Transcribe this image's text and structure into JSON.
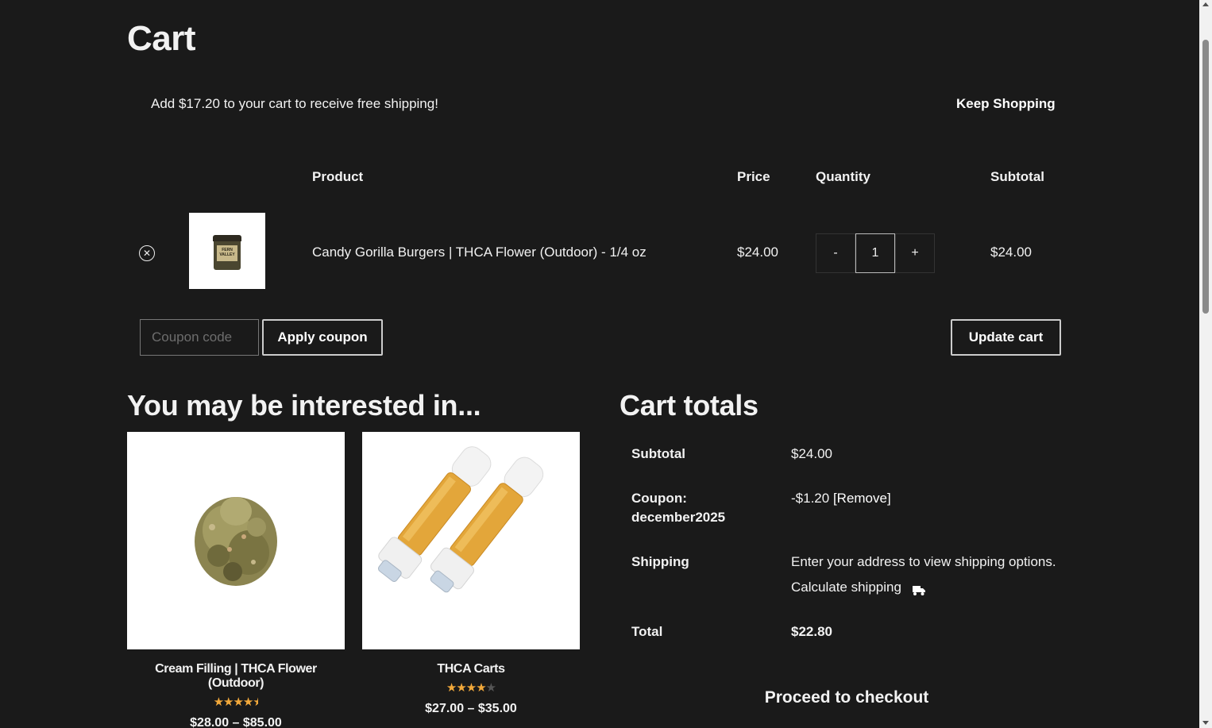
{
  "page": {
    "title": "Cart"
  },
  "notice": {
    "text": "Add $17.20 to your cart to receive free shipping!",
    "link_label": "Keep Shopping"
  },
  "cart_table": {
    "headers": {
      "product": "Product",
      "price": "Price",
      "quantity": "Quantity",
      "subtotal": "Subtotal"
    },
    "items": [
      {
        "remove_icon": "close-circle-icon",
        "thumbnail_label": "FERN VALLEY",
        "name": "Candy Gorilla Burgers | THCA Flower (Outdoor) - 1/4 oz",
        "price": "$24.00",
        "quantity": "1",
        "decrement_label": "-",
        "increment_label": "+",
        "subtotal": "$24.00"
      }
    ]
  },
  "coupon": {
    "placeholder": "Coupon code",
    "apply_label": "Apply coupon",
    "update_label": "Update cart"
  },
  "cross_sells": {
    "title": "You may be interested in...",
    "products": [
      {
        "name": "Cream Filling | THCA Flower (Outdoor)",
        "rating": 4.5,
        "price": "$28.00 – $85.00"
      },
      {
        "name": "THCA Carts",
        "rating": 4.0,
        "price": "$27.00 – $35.00"
      }
    ]
  },
  "cart_totals": {
    "title": "Cart totals",
    "subtotal_label": "Subtotal",
    "subtotal_value": "$24.00",
    "coupon_label_line1": "Coupon:",
    "coupon_label_line2": "december2025",
    "coupon_value": "-$1.20",
    "coupon_remove": "[Remove]",
    "shipping_label": "Shipping",
    "shipping_text": "Enter your address to view shipping options.",
    "calculate_shipping": "Calculate shipping",
    "calculate_icon": "truck-icon",
    "total_label": "Total",
    "total_value": "$22.80",
    "checkout_label": "Proceed to checkout"
  },
  "colors": {
    "background": "#1a1a1a",
    "text": "#f2f2f2",
    "star": "#f2a93b"
  }
}
